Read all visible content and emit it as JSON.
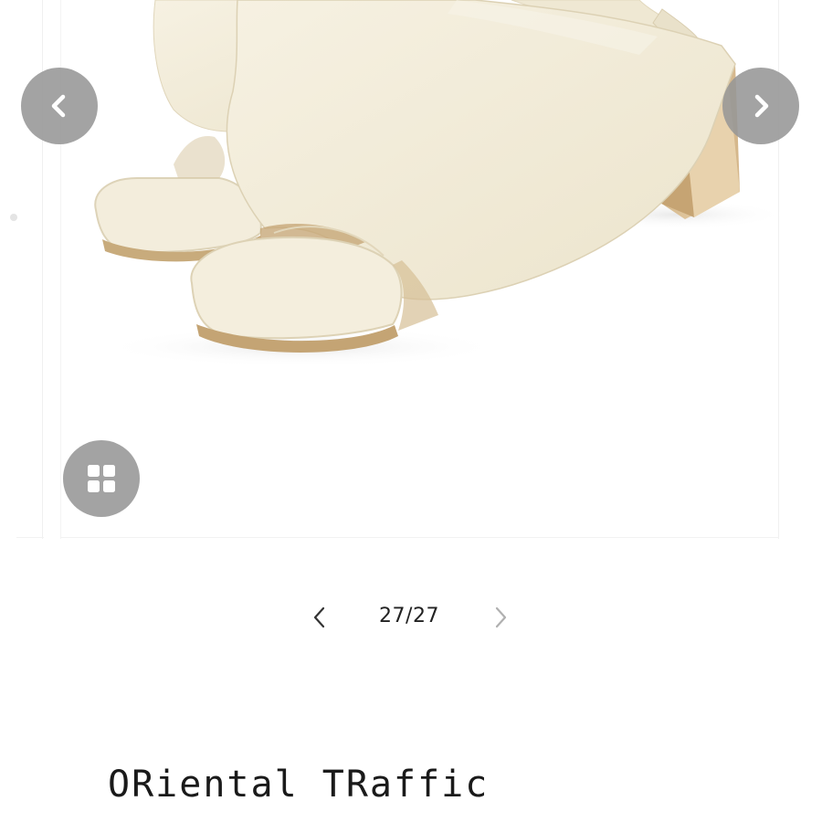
{
  "gallery": {
    "image_alt": "Cream slingback open-toe block heel mules",
    "prev_icon": "chevron-left-icon",
    "next_icon": "chevron-right-icon",
    "grid_icon": "grid-icon"
  },
  "pagination": {
    "counter": "27/27",
    "prev_icon": "chevron-left-icon",
    "next_icon": "chevron-right-icon"
  },
  "product": {
    "brand": "ORiental TRaffic"
  },
  "colors": {
    "overlay_button": "#969696",
    "shoe_leather": "#f2ecda",
    "heel": "#d6b98f",
    "text": "#1a1a1a"
  }
}
